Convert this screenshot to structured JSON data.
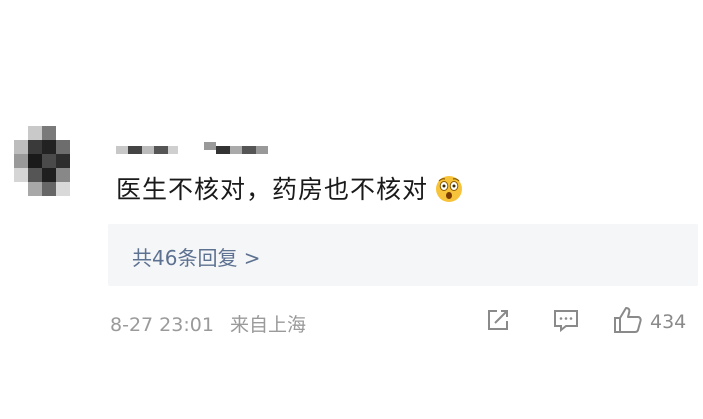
{
  "comment": {
    "text": "医生不核对，药房也不核对",
    "replies_label": "共46条回复 >",
    "date": "8-27 23:01",
    "location": "来自上海",
    "like_count": "434"
  },
  "icons": {
    "share": "share-icon",
    "reply": "reply-icon",
    "like": "thumbs-up-icon",
    "emoji": "shocked-face-emoji"
  },
  "colors": {
    "link": "#5d7191",
    "meta": "#9a9a9a",
    "reply_bg": "#f5f6f7"
  }
}
